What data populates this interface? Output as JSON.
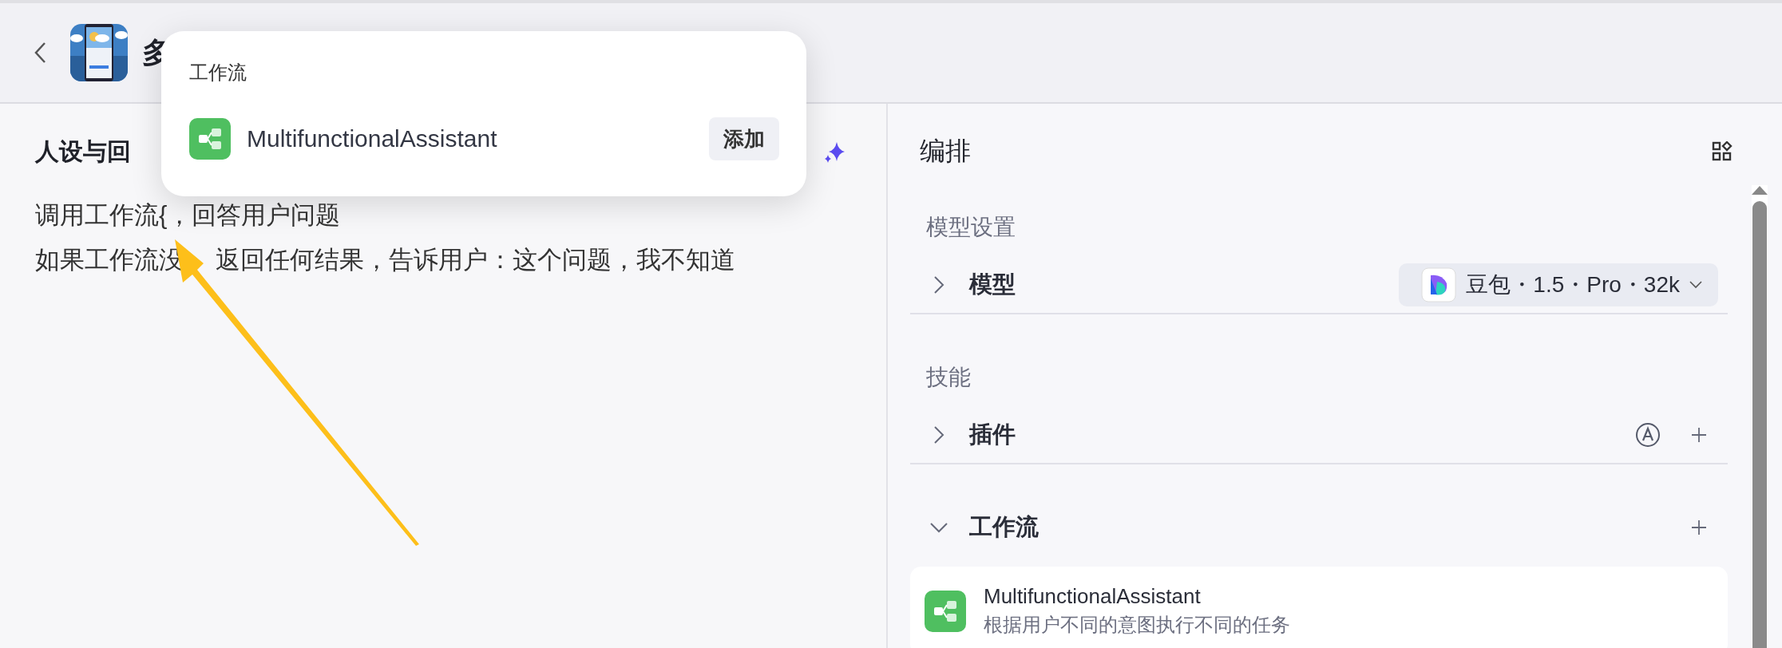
{
  "header": {
    "title": "多"
  },
  "popup": {
    "heading": "工作流",
    "items": [
      {
        "name": "MultifunctionalAssistant",
        "action": "添加"
      }
    ]
  },
  "prompt": {
    "title": "人设与回",
    "lines": [
      {
        "parts": [
          "调用工作流{，回答用户问题"
        ]
      },
      {
        "parts": [
          "如果工作流没",
          "返回任何结果，告诉用户：这个问题，我不知道"
        ]
      }
    ]
  },
  "arrange": {
    "title": "编排",
    "sections": [
      {
        "title": "模型设置",
        "rows": [
          {
            "kind": "model",
            "label": "模型",
            "expanded": false,
            "model": "豆包・1.5・Pro・32k"
          }
        ]
      },
      {
        "title": "技能",
        "rows": [
          {
            "kind": "plugin",
            "label": "插件",
            "expanded": false
          },
          {
            "kind": "workflow",
            "label": "工作流",
            "expanded": true,
            "items": [
              {
                "name": "MultifunctionalAssistant",
                "description": "根据用户不同的意图执行不同的任务"
              }
            ]
          }
        ]
      }
    ]
  }
}
